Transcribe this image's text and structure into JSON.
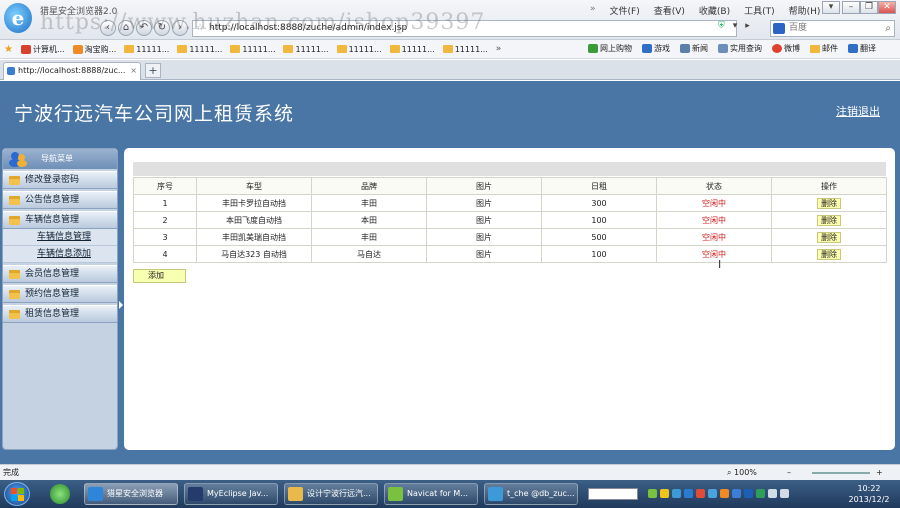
{
  "browser": {
    "app_title": "猎星安全浏览器2.0",
    "watermark": "https://www.huzhan.com/ishop39397",
    "menus": [
      "文件(F)",
      "查看(V)",
      "收藏(B)",
      "工具(T)",
      "帮助(H)"
    ],
    "address": "http://localhost:8888/zuche/admin/index.jsp",
    "search_placeholder": "百度",
    "favorites": [
      "计算机...",
      "淘宝购...",
      "11111...",
      "11111...",
      "11111...",
      "11111...",
      "11111...",
      "11111...",
      "11111..."
    ],
    "favorites_right": [
      "网上购物",
      "游戏",
      "新闻",
      "实用查询",
      "微博",
      "邮件",
      "翻译"
    ],
    "tab_label": "http://localhost:8888/zuc...",
    "status": "完成",
    "zoom": "100%"
  },
  "site": {
    "title": "宁波行远汽车公司网上租赁系统",
    "logout": "注销退出"
  },
  "sidebar": {
    "header": "导航菜单",
    "items": [
      {
        "label": "修改登录密码"
      },
      {
        "label": "公告信息管理"
      },
      {
        "label": "车辆信息管理",
        "children": [
          "车辆信息管理",
          "车辆信息添加"
        ]
      },
      {
        "label": "会员信息管理"
      },
      {
        "label": "预约信息管理"
      },
      {
        "label": "租赁信息管理"
      }
    ]
  },
  "table": {
    "columns": [
      "序号",
      "车型",
      "品牌",
      "图片",
      "日租",
      "状态",
      "操作"
    ],
    "rows": [
      {
        "no": "1",
        "model": "丰田卡罗拉自动挡",
        "brand": "丰田",
        "pic": "图片",
        "rent": "300",
        "status": "空闲中",
        "op": "删除"
      },
      {
        "no": "2",
        "model": "本田飞度自动挡",
        "brand": "本田",
        "pic": "图片",
        "rent": "100",
        "status": "空闲中",
        "op": "删除"
      },
      {
        "no": "3",
        "model": "丰田凯美瑞自动挡",
        "brand": "丰田",
        "pic": "图片",
        "rent": "500",
        "status": "空闲中",
        "op": "删除"
      },
      {
        "no": "4",
        "model": "马自达323 自动挡",
        "brand": "马自达",
        "pic": "图片",
        "rent": "100",
        "status": "空闲中",
        "op": "删除"
      }
    ],
    "add_label": "添加"
  },
  "taskbar": {
    "tasks": [
      "猎星安全浏览器",
      "MyEclipse Jav...",
      "设计宁波行远汽...",
      "Navicat for M...",
      "t_che @db_zuc..."
    ],
    "time": "10:22",
    "date": "2013/12/2"
  },
  "colors": {
    "page_bg": "#4a76a6",
    "status_red": "#d01818",
    "button_yellow": "#ffffb0"
  }
}
